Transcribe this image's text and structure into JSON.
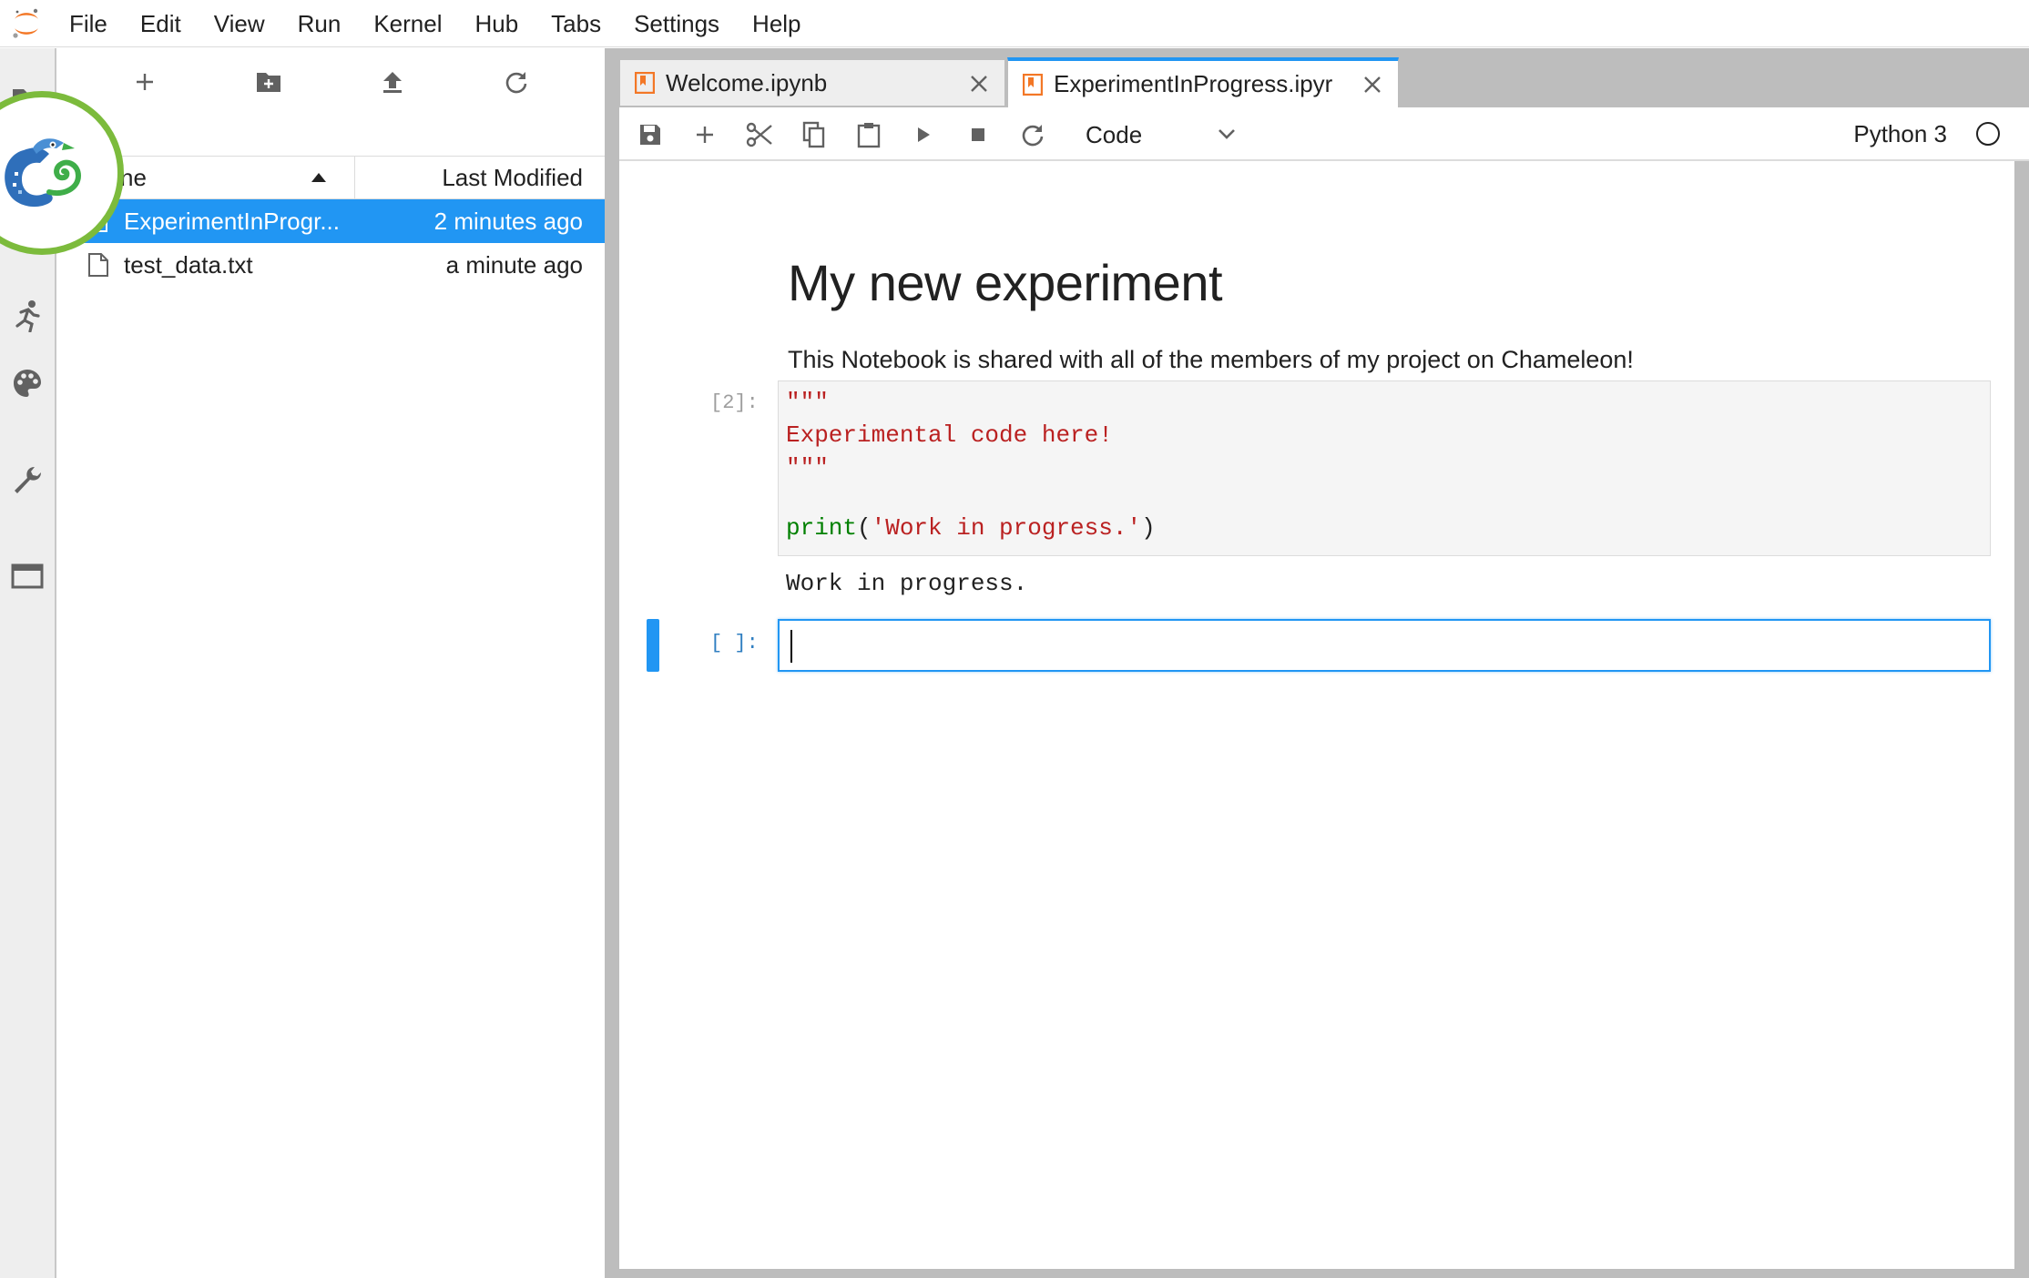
{
  "menu": {
    "items": [
      "File",
      "Edit",
      "View",
      "Run",
      "Kernel",
      "Hub",
      "Tabs",
      "Settings",
      "Help"
    ]
  },
  "activity_bar": {
    "icons": [
      "folder-icon",
      "chameleon-icon",
      "running-icon",
      "palette-icon",
      "wrench-icon",
      "tabs-icon"
    ]
  },
  "file_browser": {
    "toolbar": [
      "new-launcher-icon",
      "new-folder-icon",
      "upload-icon",
      "refresh-icon"
    ],
    "columns": {
      "name": "Name",
      "name_visible": "ne",
      "modified": "Last Modified"
    },
    "files": [
      {
        "name": "ExperimentInProgr...",
        "modified": "2 minutes ago",
        "selected": true,
        "icon": "notebook-icon"
      },
      {
        "name": "test_data.txt",
        "modified": "a minute ago",
        "selected": false,
        "icon": "file-icon"
      }
    ]
  },
  "tabs": [
    {
      "label": "Welcome.ipynb",
      "active": false
    },
    {
      "label": "ExperimentInProgress.ipyr",
      "active": true
    }
  ],
  "notebook_toolbar": {
    "buttons": [
      "save-icon",
      "add-cell-icon",
      "cut-icon",
      "copy-icon",
      "paste-icon",
      "run-icon",
      "stop-icon",
      "restart-icon"
    ],
    "cell_type": "Code",
    "kernel": "Python 3"
  },
  "notebook": {
    "title": "My new experiment",
    "paragraph": "This Notebook is shared with all of the members of my project on Chameleon!",
    "code_cell": {
      "prompt": "[2]:",
      "lines": {
        "l1": "\"\"\"",
        "l2": "Experimental code here!",
        "l3": "\"\"\"",
        "l5_fn": "print",
        "l5_open": "(",
        "l5_str": "'Work in progress.'",
        "l5_close": ")"
      },
      "output": "Work in progress."
    },
    "empty_cell": {
      "prompt": "[ ]:"
    }
  },
  "colors": {
    "accent": "#2196f3",
    "selection": "#2196f3",
    "chameleon_ring": "#7cbb3c",
    "string": "#ba2121",
    "builtin": "#008000",
    "jupyter_orange": "#f37726"
  }
}
